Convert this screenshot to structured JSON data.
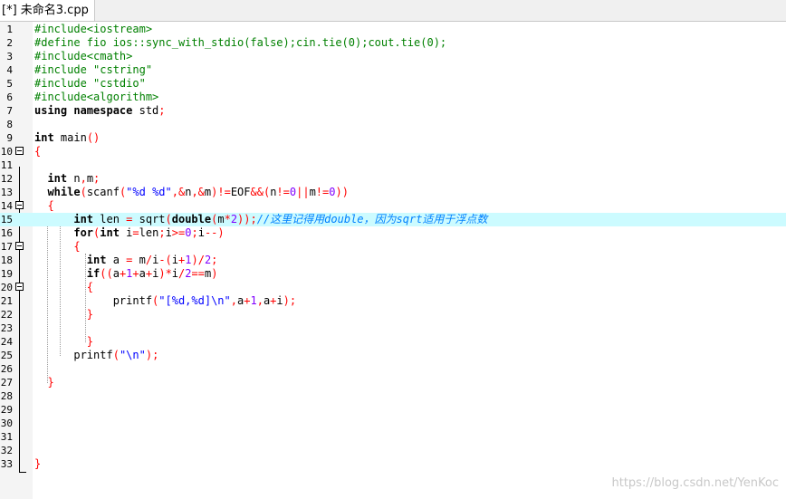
{
  "tab": {
    "title": "[*] 未命名3.cpp"
  },
  "watermark": "https://blog.csdn.net/YenKoc",
  "lines": [
    {
      "n": "1",
      "tokens": [
        {
          "t": "#include<iostream>",
          "c": "pp"
        }
      ]
    },
    {
      "n": "2",
      "tokens": [
        {
          "t": "#define fio ios::sync_with_stdio(false);cin.tie(0);cout.tie(0);",
          "c": "pp"
        }
      ]
    },
    {
      "n": "3",
      "tokens": [
        {
          "t": "#include<cmath>",
          "c": "pp"
        }
      ]
    },
    {
      "n": "4",
      "tokens": [
        {
          "t": "#include \"cstring\"",
          "c": "pp"
        }
      ]
    },
    {
      "n": "5",
      "tokens": [
        {
          "t": "#include \"cstdio\"",
          "c": "pp"
        }
      ]
    },
    {
      "n": "6",
      "tokens": [
        {
          "t": "#include<algorithm>",
          "c": "pp"
        }
      ]
    },
    {
      "n": "7",
      "tokens": [
        {
          "t": "using namespace",
          "c": "kw"
        },
        {
          "t": " std",
          "c": "tx"
        },
        {
          "t": ";",
          "c": "op"
        }
      ]
    },
    {
      "n": "8",
      "tokens": []
    },
    {
      "n": "9",
      "tokens": [
        {
          "t": "int",
          "c": "kw"
        },
        {
          "t": " main",
          "c": "tx"
        },
        {
          "t": "()",
          "c": "op"
        }
      ]
    },
    {
      "n": "10",
      "fold": true,
      "tokens": [
        {
          "t": "{",
          "c": "op"
        }
      ]
    },
    {
      "n": "11",
      "tokens": []
    },
    {
      "n": "12",
      "tokens": [
        {
          "t": "  int",
          "c": "kw"
        },
        {
          "t": " n",
          "c": "tx"
        },
        {
          "t": ",",
          "c": "op"
        },
        {
          "t": "m",
          "c": "tx"
        },
        {
          "t": ";",
          "c": "op"
        }
      ]
    },
    {
      "n": "13",
      "tokens": [
        {
          "t": "  while",
          "c": "kw"
        },
        {
          "t": "(",
          "c": "op"
        },
        {
          "t": "scanf",
          "c": "tx"
        },
        {
          "t": "(",
          "c": "op"
        },
        {
          "t": "\"%d %d\"",
          "c": "str"
        },
        {
          "t": ",&",
          "c": "op"
        },
        {
          "t": "n",
          "c": "tx"
        },
        {
          "t": ",&",
          "c": "op"
        },
        {
          "t": "m",
          "c": "tx"
        },
        {
          "t": ")!=",
          "c": "op"
        },
        {
          "t": "EOF",
          "c": "tx"
        },
        {
          "t": "&&(",
          "c": "op"
        },
        {
          "t": "n",
          "c": "tx"
        },
        {
          "t": "!=",
          "c": "op"
        },
        {
          "t": "0",
          "c": "num"
        },
        {
          "t": "||",
          "c": "op"
        },
        {
          "t": "m",
          "c": "tx"
        },
        {
          "t": "!=",
          "c": "op"
        },
        {
          "t": "0",
          "c": "num"
        },
        {
          "t": "))",
          "c": "op"
        }
      ]
    },
    {
      "n": "14",
      "fold": true,
      "tokens": [
        {
          "t": "  {",
          "c": "op"
        }
      ]
    },
    {
      "n": "15",
      "hl": true,
      "tokens": [
        {
          "t": "      int",
          "c": "kw"
        },
        {
          "t": " len ",
          "c": "tx"
        },
        {
          "t": "=",
          "c": "op"
        },
        {
          "t": " sqrt",
          "c": "tx"
        },
        {
          "t": "(",
          "c": "op"
        },
        {
          "t": "double",
          "c": "kw"
        },
        {
          "t": "(",
          "c": "op"
        },
        {
          "t": "m",
          "c": "tx"
        },
        {
          "t": "*",
          "c": "op"
        },
        {
          "t": "2",
          "c": "num"
        },
        {
          "t": "));",
          "c": "op"
        },
        {
          "t": "//这里记得用double，因为sqrt适用于浮点数",
          "c": "cm"
        }
      ]
    },
    {
      "n": "16",
      "tokens": [
        {
          "t": "      for",
          "c": "kw"
        },
        {
          "t": "(",
          "c": "op"
        },
        {
          "t": "int",
          "c": "kw"
        },
        {
          "t": " i",
          "c": "tx"
        },
        {
          "t": "=",
          "c": "op"
        },
        {
          "t": "len",
          "c": "tx"
        },
        {
          "t": ";",
          "c": "op"
        },
        {
          "t": "i",
          "c": "tx"
        },
        {
          "t": ">=",
          "c": "op"
        },
        {
          "t": "0",
          "c": "num"
        },
        {
          "t": ";",
          "c": "op"
        },
        {
          "t": "i",
          "c": "tx"
        },
        {
          "t": "--)",
          "c": "op"
        }
      ]
    },
    {
      "n": "17",
      "fold": true,
      "tokens": [
        {
          "t": "      {",
          "c": "op"
        }
      ]
    },
    {
      "n": "18",
      "tokens": [
        {
          "t": "        int",
          "c": "kw"
        },
        {
          "t": " a ",
          "c": "tx"
        },
        {
          "t": "=",
          "c": "op"
        },
        {
          "t": " m",
          "c": "tx"
        },
        {
          "t": "/",
          "c": "op"
        },
        {
          "t": "i",
          "c": "tx"
        },
        {
          "t": "-(",
          "c": "op"
        },
        {
          "t": "i",
          "c": "tx"
        },
        {
          "t": "+",
          "c": "op"
        },
        {
          "t": "1",
          "c": "num"
        },
        {
          "t": ")/",
          "c": "op"
        },
        {
          "t": "2",
          "c": "num"
        },
        {
          "t": ";",
          "c": "op"
        }
      ]
    },
    {
      "n": "19",
      "tokens": [
        {
          "t": "        if",
          "c": "kw"
        },
        {
          "t": "((",
          "c": "op"
        },
        {
          "t": "a",
          "c": "tx"
        },
        {
          "t": "+",
          "c": "op"
        },
        {
          "t": "1",
          "c": "num"
        },
        {
          "t": "+",
          "c": "op"
        },
        {
          "t": "a",
          "c": "tx"
        },
        {
          "t": "+",
          "c": "op"
        },
        {
          "t": "i",
          "c": "tx"
        },
        {
          "t": ")*",
          "c": "op"
        },
        {
          "t": "i",
          "c": "tx"
        },
        {
          "t": "/",
          "c": "op"
        },
        {
          "t": "2",
          "c": "num"
        },
        {
          "t": "==",
          "c": "op"
        },
        {
          "t": "m",
          "c": "tx"
        },
        {
          "t": ")",
          "c": "op"
        }
      ]
    },
    {
      "n": "20",
      "fold": true,
      "tokens": [
        {
          "t": "        {",
          "c": "op"
        }
      ]
    },
    {
      "n": "21",
      "tokens": [
        {
          "t": "            printf",
          "c": "tx"
        },
        {
          "t": "(",
          "c": "op"
        },
        {
          "t": "\"[%d,%d]\\n\"",
          "c": "str"
        },
        {
          "t": ",",
          "c": "op"
        },
        {
          "t": "a",
          "c": "tx"
        },
        {
          "t": "+",
          "c": "op"
        },
        {
          "t": "1",
          "c": "num"
        },
        {
          "t": ",",
          "c": "op"
        },
        {
          "t": "a",
          "c": "tx"
        },
        {
          "t": "+",
          "c": "op"
        },
        {
          "t": "i",
          "c": "tx"
        },
        {
          "t": ");",
          "c": "op"
        }
      ]
    },
    {
      "n": "22",
      "tokens": [
        {
          "t": "        }",
          "c": "op"
        }
      ]
    },
    {
      "n": "23",
      "tokens": []
    },
    {
      "n": "24",
      "tokens": [
        {
          "t": "        }",
          "c": "op"
        }
      ]
    },
    {
      "n": "25",
      "tokens": [
        {
          "t": "      printf",
          "c": "tx"
        },
        {
          "t": "(",
          "c": "op"
        },
        {
          "t": "\"\\n\"",
          "c": "str"
        },
        {
          "t": ");",
          "c": "op"
        }
      ]
    },
    {
      "n": "26",
      "tokens": []
    },
    {
      "n": "27",
      "tokens": [
        {
          "t": "  }",
          "c": "op"
        }
      ]
    },
    {
      "n": "28",
      "tokens": []
    },
    {
      "n": "29",
      "tokens": []
    },
    {
      "n": "30",
      "tokens": []
    },
    {
      "n": "31",
      "tokens": []
    },
    {
      "n": "32",
      "tokens": []
    },
    {
      "n": "33",
      "tokens": [
        {
          "t": "}",
          "c": "op"
        }
      ]
    }
  ]
}
